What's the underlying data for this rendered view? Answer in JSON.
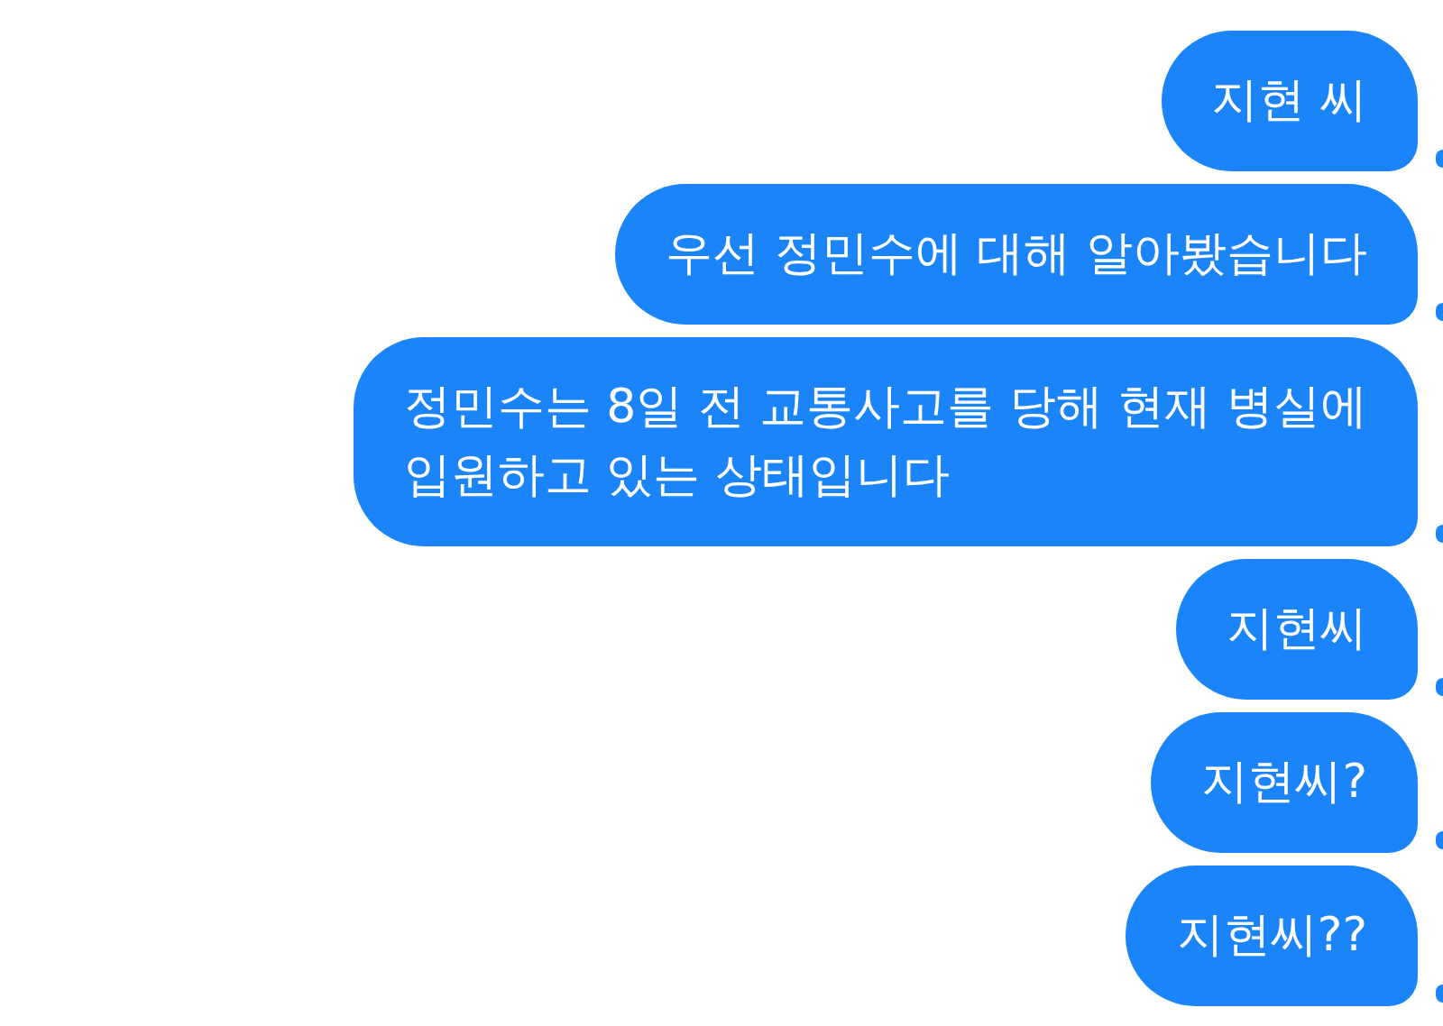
{
  "messages": [
    {
      "lines": [
        "지현 씨"
      ]
    },
    {
      "lines": [
        "우선 정민수에 대해 알아봤습니다"
      ]
    },
    {
      "lines": [
        "정민수는 8일 전 교통사고를 당해 현재 병실에",
        "입원하고 있는 상태입니다"
      ]
    },
    {
      "lines": [
        "지현씨"
      ]
    },
    {
      "lines": [
        "지현씨?"
      ]
    },
    {
      "lines": [
        "지현씨??"
      ]
    }
  ]
}
